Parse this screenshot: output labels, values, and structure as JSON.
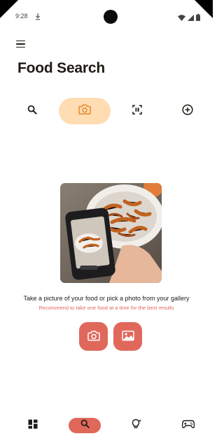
{
  "status_bar": {
    "time": "9:28",
    "icons": [
      "download-icon",
      "wifi-icon",
      "signal-icon",
      "battery-icon"
    ]
  },
  "app_bar": {
    "menu_icon": "menu-icon",
    "title": "Food Search"
  },
  "search_tabs": {
    "items": [
      {
        "icon": "search-icon",
        "selected": false
      },
      {
        "icon": "camera-icon",
        "selected": true
      },
      {
        "icon": "barcode-scan-icon",
        "selected": false
      },
      {
        "icon": "add-circle-icon",
        "selected": false
      }
    ]
  },
  "photo_search": {
    "prompt": "Take a picture of your food or pick a photo from your gallery",
    "hint": "Recommend to take one food at a time for the best results",
    "actions": [
      {
        "icon": "camera-icon"
      },
      {
        "icon": "image-gallery-icon"
      }
    ]
  },
  "bottom_nav": {
    "items": [
      {
        "icon": "dashboard-icon",
        "selected": false
      },
      {
        "icon": "search-icon",
        "selected": true
      },
      {
        "icon": "lightbulb-icon",
        "selected": false
      },
      {
        "icon": "gamepad-icon",
        "selected": false
      }
    ]
  },
  "colors": {
    "accent": "#e0685b",
    "tab_selected": "#ffdcb2",
    "tab_icon_selected": "#e8892b",
    "text": "#1f1b16"
  }
}
